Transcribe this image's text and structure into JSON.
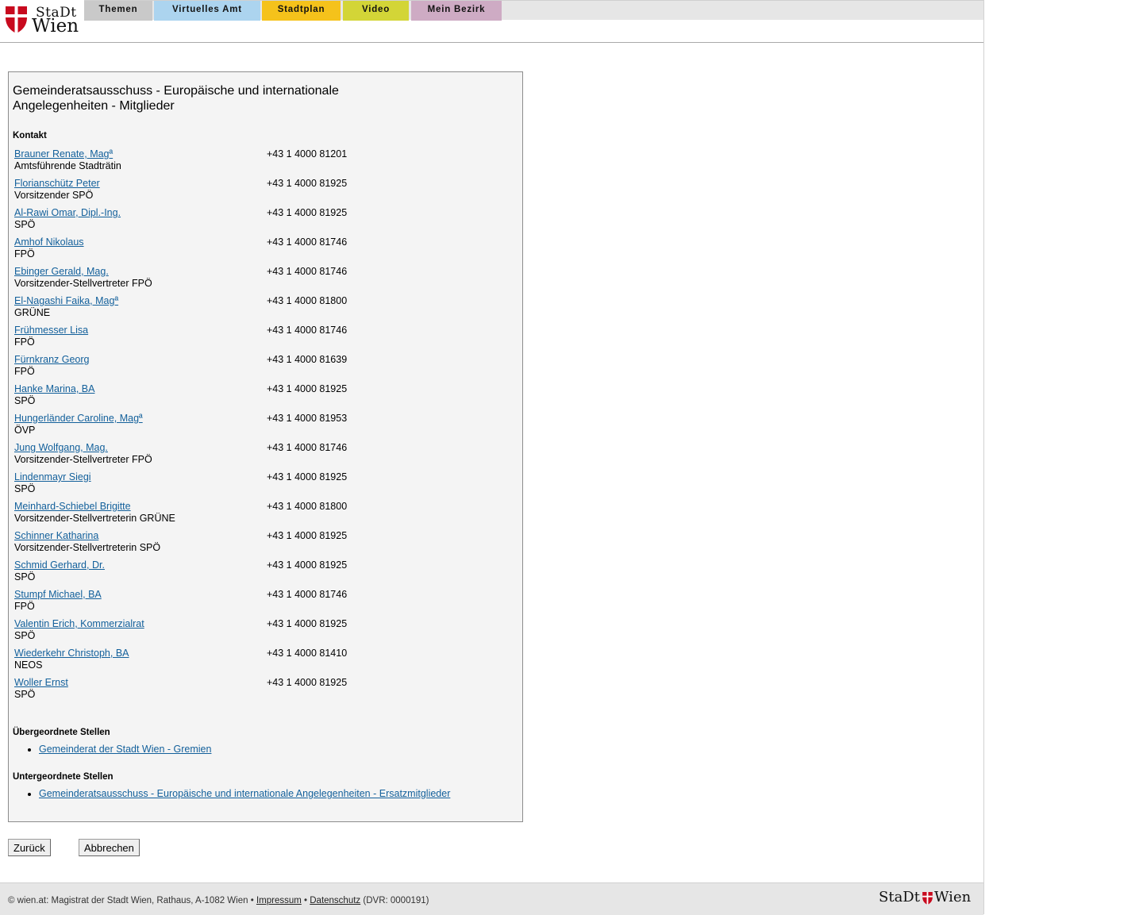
{
  "logo": {
    "line1": "StaDt",
    "line2": "Wien",
    "shield_color": "#c80a1e"
  },
  "nav": {
    "tabs": [
      {
        "label": "Themen",
        "color": "#c9c9c9"
      },
      {
        "label": "Virtuelles Amt",
        "color": "#acd4ef"
      },
      {
        "label": "Stadtplan",
        "color": "#f5c21b"
      },
      {
        "label": "Video",
        "color": "#d3d537"
      },
      {
        "label": "Mein Bezirk",
        "color": "#ceabc4"
      }
    ]
  },
  "main": {
    "title": "Gemeinderatsausschuss - Europäische und internationale Angelegenheiten - Mitglieder",
    "contact_label": "Kontakt",
    "contacts": [
      {
        "name": "Brauner Renate, Magª",
        "role": "Amtsführende Stadträtin",
        "phone": "+43 1 4000 81201"
      },
      {
        "name": "Florianschütz Peter",
        "role": "Vorsitzender SPÖ",
        "phone": "+43 1 4000 81925"
      },
      {
        "name": "Al-Rawi Omar, Dipl.-Ing.",
        "role": "SPÖ",
        "phone": "+43 1 4000 81925"
      },
      {
        "name": "Amhof Nikolaus",
        "role": "FPÖ",
        "phone": "+43 1 4000 81746"
      },
      {
        "name": "Ebinger Gerald, Mag.",
        "role": "Vorsitzender-Stellvertreter FPÖ",
        "phone": "+43 1 4000 81746"
      },
      {
        "name": "El-Nagashi Faika, Magª",
        "role": "GRÜNE",
        "phone": "+43 1 4000 81800"
      },
      {
        "name": "Frühmesser Lisa",
        "role": "FPÖ",
        "phone": "+43 1 4000 81746"
      },
      {
        "name": "Fürnkranz Georg",
        "role": "FPÖ",
        "phone": "+43 1 4000 81639"
      },
      {
        "name": "Hanke Marina, BA",
        "role": "SPÖ",
        "phone": "+43 1 4000 81925"
      },
      {
        "name": "Hungerländer Caroline, Magª",
        "role": "ÖVP",
        "phone": "+43 1 4000 81953"
      },
      {
        "name": "Jung Wolfgang, Mag.",
        "role": "Vorsitzender-Stellvertreter FPÖ",
        "phone": "+43 1 4000 81746"
      },
      {
        "name": "Lindenmayr Siegi",
        "role": "SPÖ",
        "phone": "+43 1 4000 81925"
      },
      {
        "name": "Meinhard-Schiebel Brigitte",
        "role": "Vorsitzender-Stellvertreterin GRÜNE",
        "phone": "+43 1 4000 81800"
      },
      {
        "name": "Schinner Katharina",
        "role": "Vorsitzender-Stellvertreterin SPÖ",
        "phone": "+43 1 4000 81925"
      },
      {
        "name": "Schmid Gerhard, Dr.",
        "role": "SPÖ",
        "phone": "+43 1 4000 81925"
      },
      {
        "name": "Stumpf Michael, BA",
        "role": "FPÖ",
        "phone": "+43 1 4000 81746"
      },
      {
        "name": "Valentin Erich, Kommerzialrat",
        "role": "SPÖ",
        "phone": "+43 1 4000 81925"
      },
      {
        "name": "Wiederkehr Christoph, BA",
        "role": "NEOS",
        "phone": "+43 1 4000 81410"
      },
      {
        "name": "Woller Ernst",
        "role": "SPÖ",
        "phone": "+43 1 4000 81925"
      }
    ],
    "parent_label": "Übergeordnete Stellen",
    "parent_links": [
      "Gemeinderat der Stadt Wien - Gremien"
    ],
    "child_label": "Untergeordnete Stellen",
    "child_links": [
      "Gemeinderatsausschuss - Europäische und internationale Angelegenheiten - Ersatzmitglieder"
    ]
  },
  "buttons": {
    "back": "Zurück",
    "cancel": "Abbrechen"
  },
  "footer": {
    "prefix": "© wien.at: Magistrat der Stadt Wien, Rathaus, A-1082 Wien •",
    "impressum": "Impressum",
    "sep": "•",
    "datenschutz": "Datenschutz",
    "dvr": "(DVR: 0000191)",
    "logo_left": "StaDt",
    "logo_right": "Wien"
  }
}
